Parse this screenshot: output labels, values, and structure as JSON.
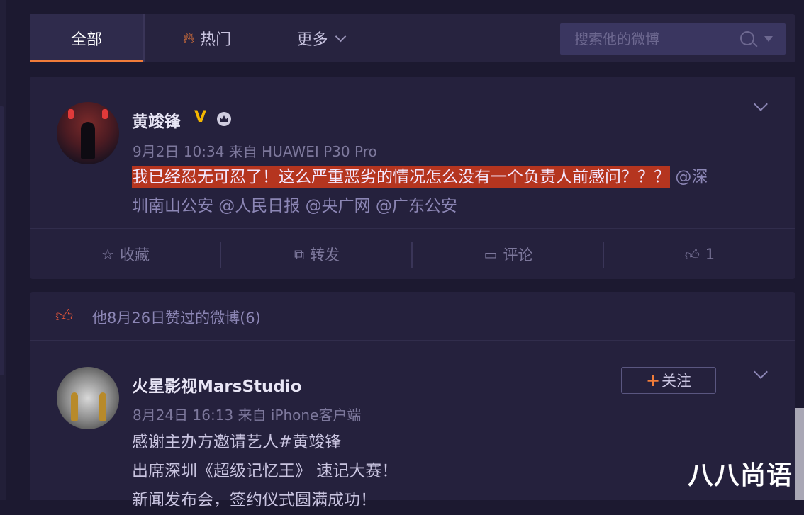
{
  "nav": {
    "tab_all": "全部",
    "tab_hot": "热门",
    "tab_more": "更多",
    "search_placeholder": "搜索他的微博"
  },
  "post1": {
    "author": "黄竣锋",
    "verified_badge": "V",
    "meta": "9月2日 10:34 来自 HUAWEI P30 Pro",
    "highlighted_text": "我已经忍无可忍了！这么严重恶劣的情况怎么没有一个负责人前感问？？？",
    "mention_line1": "@深",
    "mention_line2": "圳南山公安 @人民日报 @央广网 @广东公安",
    "actions": {
      "favorite": "收藏",
      "repost": "转发",
      "comment": "评论",
      "like_count": "1"
    }
  },
  "liked": {
    "header": "他8月26日赞过的微博(6)",
    "post": {
      "author": "火星影视MarsStudio",
      "follow_label": "关注",
      "meta": "8月24日 16:13 来自 iPhone客户端",
      "lines": [
        "感谢主办方邀请艺人#黄竣锋",
        "出席深圳《超级记忆王》 速记大赛！",
        "新闻发布会，签约仪式圆满成功！"
      ]
    }
  },
  "watermark": "八八尚语",
  "colors": {
    "background": "#1c1930",
    "card": "#25213d",
    "accent": "#f07c3a",
    "highlight": "#b5351f",
    "verified": "#f5b700"
  },
  "icons": [
    "fire-icon",
    "chevron-down-icon",
    "search-icon",
    "star-icon",
    "repost-icon",
    "comment-icon",
    "thumbs-up-icon",
    "crown-icon",
    "plus-icon"
  ]
}
